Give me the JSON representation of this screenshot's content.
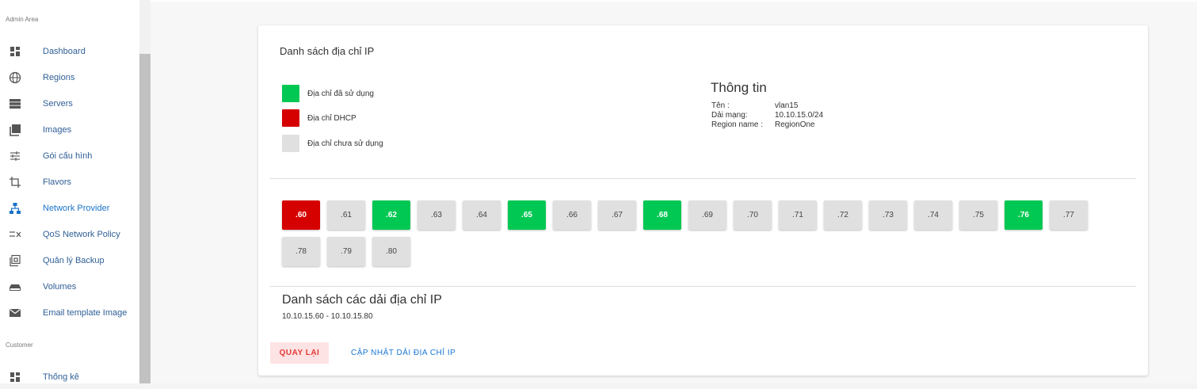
{
  "sidebar": {
    "section_admin": "Admin Area",
    "section_customer": "Customer",
    "items": [
      {
        "label": "Dashboard",
        "icon": "dashboard-icon"
      },
      {
        "label": "Regions",
        "icon": "globe-icon"
      },
      {
        "label": "Servers",
        "icon": "servers-icon"
      },
      {
        "label": "Images",
        "icon": "images-icon"
      },
      {
        "label": "Gói cấu hình",
        "icon": "tune-icon"
      },
      {
        "label": "Flavors",
        "icon": "crop-icon"
      },
      {
        "label": "Network Provider",
        "icon": "network-icon",
        "active": true
      },
      {
        "label": "QoS Network Policy",
        "icon": "qos-icon"
      },
      {
        "label": "Quản lý Backup",
        "icon": "backup-icon"
      },
      {
        "label": "Volumes",
        "icon": "volumes-icon"
      },
      {
        "label": "Email template Image",
        "icon": "email-icon"
      }
    ],
    "customer_items": [
      {
        "label": "Thống kê",
        "icon": "stats-icon"
      }
    ]
  },
  "card": {
    "title": "Danh sách địa chỉ IP",
    "legend": [
      {
        "label": "Địa chỉ đã sử dụng",
        "color": "#00c853"
      },
      {
        "label": "Địa chỉ DHCP",
        "color": "#d50000"
      },
      {
        "label": "Địa chỉ chưa sử dụng",
        "color": "#e0e0e0"
      }
    ],
    "info": {
      "title": "Thông tin",
      "rows": [
        {
          "key": "Tên :",
          "value": "vlan15"
        },
        {
          "key": "Dải mạng:",
          "value": "10.10.15.0/24"
        },
        {
          "key": "Region name :",
          "value": "RegionOne"
        }
      ]
    },
    "ips": [
      {
        "label": ".60",
        "status": "dhcp"
      },
      {
        "label": ".61",
        "status": "free"
      },
      {
        "label": ".62",
        "status": "used"
      },
      {
        "label": ".63",
        "status": "free"
      },
      {
        "label": ".64",
        "status": "free"
      },
      {
        "label": ".65",
        "status": "used"
      },
      {
        "label": ".66",
        "status": "free"
      },
      {
        "label": ".67",
        "status": "free"
      },
      {
        "label": ".68",
        "status": "used"
      },
      {
        "label": ".69",
        "status": "free"
      },
      {
        "label": ".70",
        "status": "free"
      },
      {
        "label": ".71",
        "status": "free"
      },
      {
        "label": ".72",
        "status": "free"
      },
      {
        "label": ".73",
        "status": "free"
      },
      {
        "label": ".74",
        "status": "free"
      },
      {
        "label": ".75",
        "status": "free"
      },
      {
        "label": ".76",
        "status": "used"
      },
      {
        "label": ".77",
        "status": "free"
      },
      {
        "label": ".78",
        "status": "free"
      },
      {
        "label": ".79",
        "status": "free"
      },
      {
        "label": ".80",
        "status": "free"
      }
    ],
    "range_title": "Danh sách các dải địa chỉ IP",
    "range_value": "10.10.15.60 - 10.10.15.80",
    "back_label": "QUAY LẠI",
    "update_label": "CẬP NHẬT DẢI ĐỊA CHỈ IP"
  }
}
